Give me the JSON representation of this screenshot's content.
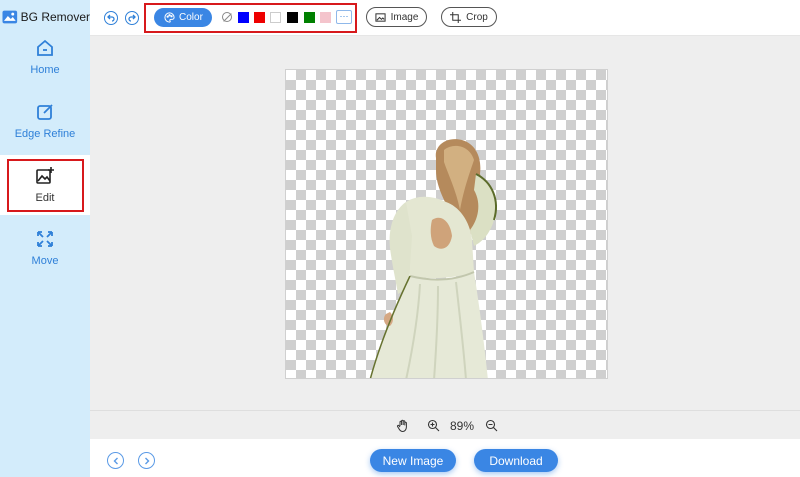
{
  "app": {
    "title": "BG Remover"
  },
  "sidebar": {
    "items": [
      {
        "label": "Home",
        "icon": "home-icon"
      },
      {
        "label": "Edge Refine",
        "icon": "edge-refine-icon"
      },
      {
        "label": "Edit",
        "icon": "edit-image-icon",
        "active": true
      },
      {
        "label": "Move",
        "icon": "move-icon"
      }
    ]
  },
  "toolbar": {
    "undo_icon": "undo-icon",
    "redo_icon": "redo-icon",
    "color_label": "Color",
    "swatches": [
      {
        "name": "none",
        "color": "transparent"
      },
      {
        "name": "blue",
        "color": "#0000ff"
      },
      {
        "name": "red",
        "color": "#ee0000"
      },
      {
        "name": "white",
        "color": "#ffffff"
      },
      {
        "name": "black",
        "color": "#000000"
      },
      {
        "name": "green",
        "color": "#008000"
      },
      {
        "name": "pink",
        "color": "#f4c4cc"
      }
    ],
    "more_label": "···",
    "image_label": "Image",
    "crop_label": "Crop"
  },
  "zoom": {
    "value": "89%"
  },
  "bottom": {
    "new_image_label": "New Image",
    "download_label": "Download"
  },
  "colors": {
    "accent": "#3a86e4",
    "sidebar_bg": "#d3ecfb",
    "highlight": "#d7191c",
    "canvas_bg": "#eeeeee"
  }
}
